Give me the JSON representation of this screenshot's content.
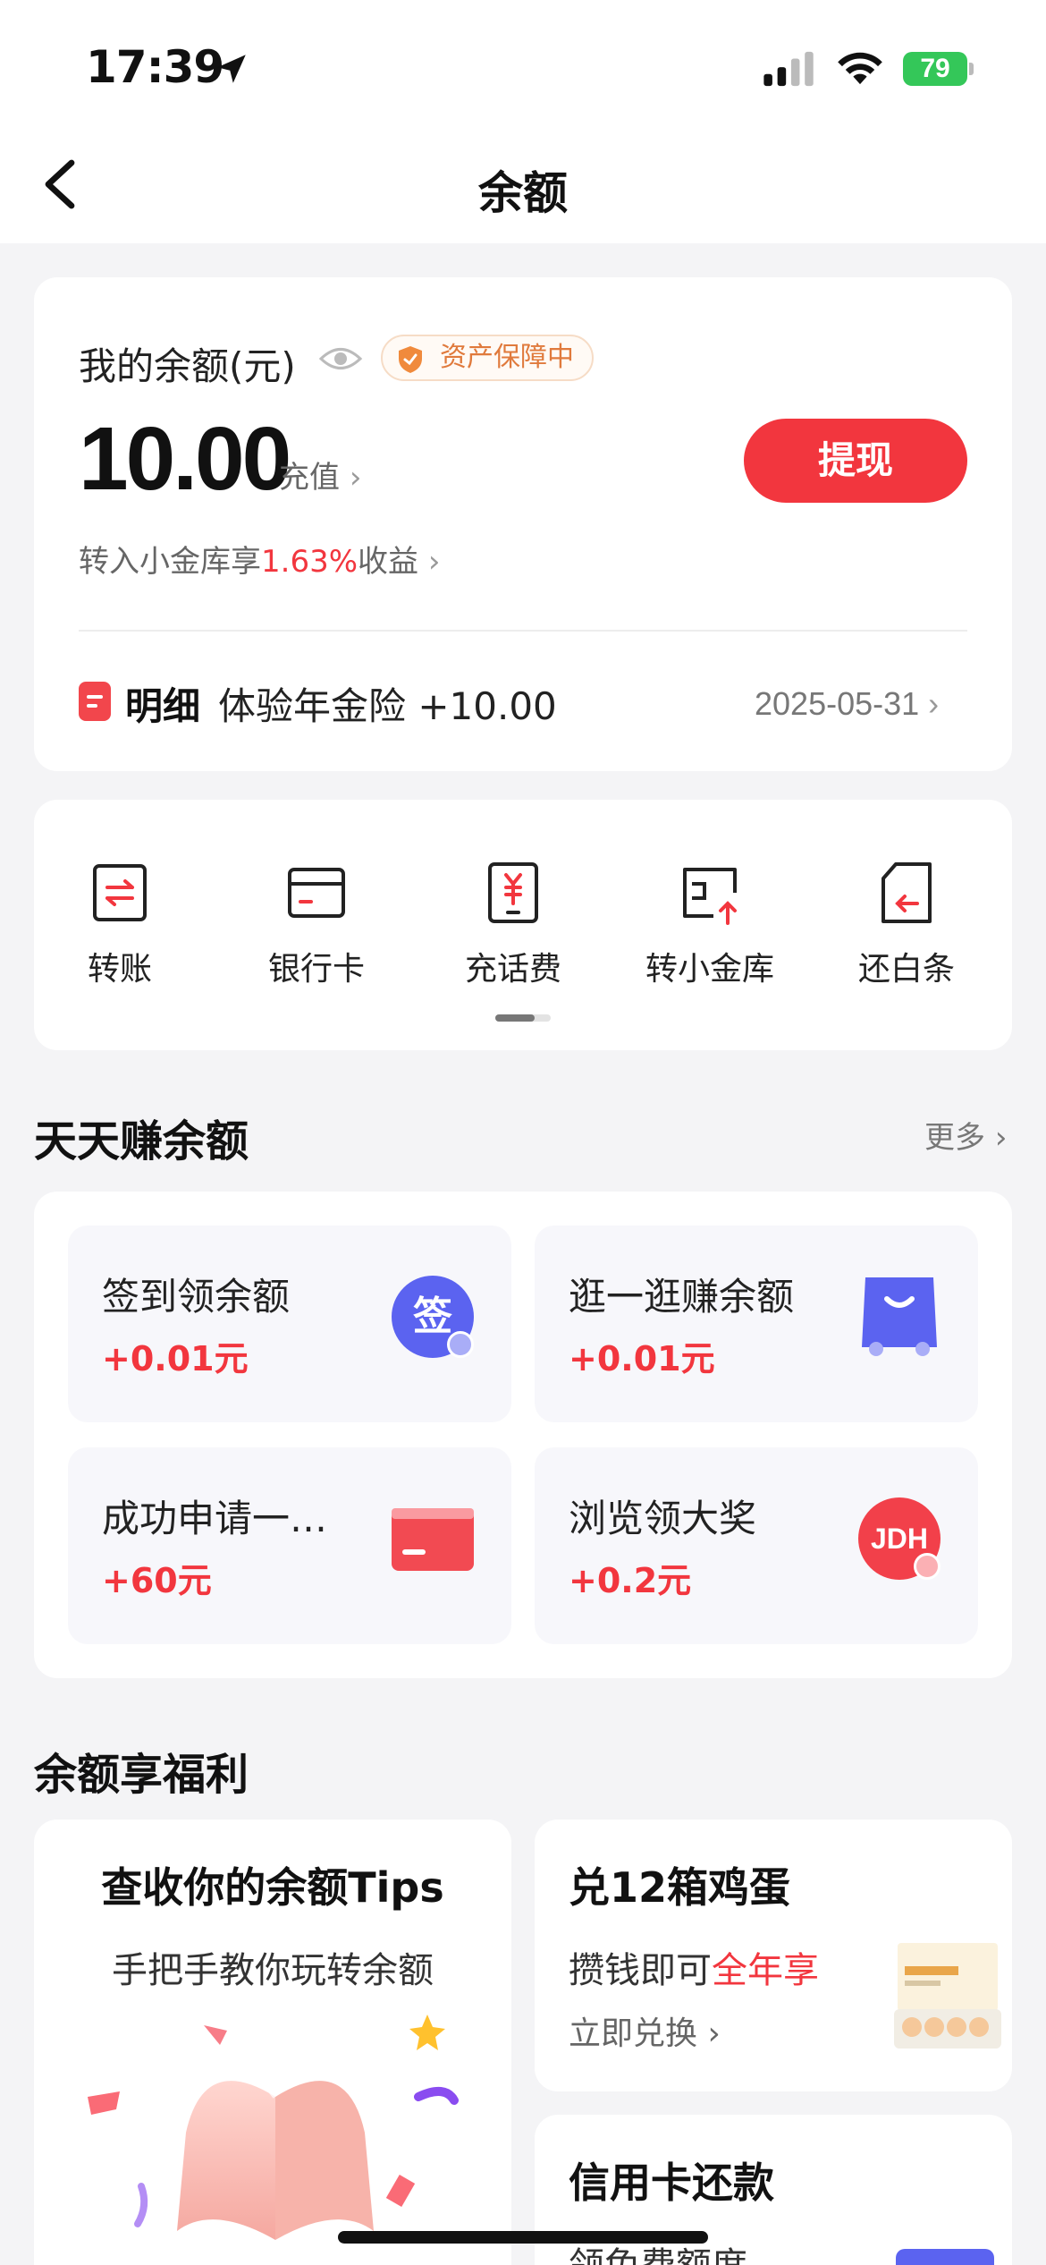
{
  "status_bar": {
    "time": "17:39",
    "battery": "79"
  },
  "nav": {
    "title": "余额"
  },
  "balance": {
    "label": "我的余额(元)",
    "badge": "资产保障中",
    "amount": "10.00",
    "topup": "充值",
    "withdraw": "提现",
    "yield_prefix": "转入小金库享",
    "yield_rate": "1.63%",
    "yield_suffix": "收益",
    "detail_title": "明细",
    "detail_desc": "体验年金险 +10.00",
    "detail_date": "2025-05-31"
  },
  "actions": [
    {
      "label": "转账",
      "icon": "transfer-icon"
    },
    {
      "label": "银行卡",
      "icon": "bank-card-icon"
    },
    {
      "label": "充话费",
      "icon": "phone-recharge-icon"
    },
    {
      "label": "转小金库",
      "icon": "vault-icon"
    },
    {
      "label": "还白条",
      "icon": "repay-icon"
    }
  ],
  "earn": {
    "title": "天天赚余额",
    "more": "更多",
    "tiles": [
      {
        "name": "签到领余额",
        "reward": "+0.01元",
        "icon": "sign-in-icon",
        "icon_text": "签"
      },
      {
        "name": "逛一逛赚余额",
        "reward": "+0.01元",
        "icon": "shopping-bag-icon"
      },
      {
        "name": "成功申请一…",
        "reward": "+60元",
        "icon": "credit-card-icon"
      },
      {
        "name": "浏览领大奖",
        "reward": "+0.2元",
        "icon": "jdh-logo-icon",
        "icon_text": "JDH"
      }
    ]
  },
  "benefits": {
    "title": "余额享福利",
    "tips": {
      "title": "查收你的余额Tips",
      "subtitle": "手把手教你玩转余额"
    },
    "eggs": {
      "title": "兑12箱鸡蛋",
      "sub_prefix": "攒钱即可",
      "sub_highlight": "全年享",
      "link": "立即兑换"
    },
    "credit": {
      "title": "信用卡还款",
      "sub": "领免费额度"
    }
  },
  "colors": {
    "accent": "#f2363e",
    "background": "#f4f4f6"
  }
}
